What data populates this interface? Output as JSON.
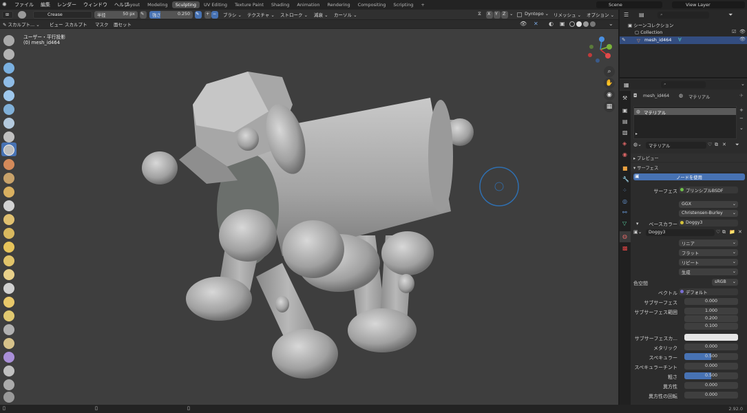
{
  "menu": {
    "items": [
      "ファイル",
      "編集",
      "レンダー",
      "ウィンドウ",
      "ヘルプ"
    ]
  },
  "workspace_tabs": [
    {
      "label": "Layout"
    },
    {
      "label": "Modeling"
    },
    {
      "label": "Sculpting",
      "active": true
    },
    {
      "label": "UV Editing"
    },
    {
      "label": "Texture Paint"
    },
    {
      "label": "Shading"
    },
    {
      "label": "Animation"
    },
    {
      "label": "Rendering"
    },
    {
      "label": "Compositing"
    },
    {
      "label": "Scripting"
    }
  ],
  "scene": {
    "name": "Scene",
    "view_layer": "View Layer"
  },
  "tool_header": {
    "brush": "Crease",
    "radius_label": "半径",
    "radius_value": "50 px",
    "strength_label": "強さ",
    "strength_value": "0.250",
    "plus": "+",
    "minus": "−",
    "brush_menu": "ブラシ",
    "texture_menu": "テクスチャ",
    "stroke_menu": "ストローク",
    "falloff_menu": "減衰",
    "cursor_menu": "カーソル",
    "dyntopo": "Dyntopo",
    "remesh": "リメッシュ",
    "options": "オプション",
    "x": "X",
    "y": "Y",
    "z": "Z"
  },
  "viewport_header": {
    "mode": "スカルプト...",
    "view": "ビュー",
    "sculpt": "スカルプト",
    "mask": "マスク",
    "face_sets": "面セット"
  },
  "viewport": {
    "view_name": "ユーザー・平行投影",
    "object_label": "(0) mesh_id464",
    "mesh_color": "#b8b8b8",
    "brush_circle_color": "#2f6fb0"
  },
  "outliner": {
    "search_placeholder": "",
    "scene_collection": "シーンコレクション",
    "collection": "Collection",
    "object": "mesh_id464"
  },
  "properties": {
    "object_name": "mesh_id464",
    "material_tab": "マテリアル",
    "slot_name": "マテリアル",
    "material_name": "マテリアル",
    "preview": "プレビュー",
    "surface_section": "サーフェス",
    "use_nodes": "ノードを使用",
    "surface_label": "サーフェス",
    "surface_value": "プリンシプルBSDF",
    "distribution": "GGX",
    "subsurface_method": "Christensen-Burley",
    "base_color_label": "ベースカラー",
    "base_color_value": "Doggy3",
    "image_name": "Doggy3",
    "interpolation": "リニア",
    "projection": "フラット",
    "extension": "リピート",
    "source": "生成",
    "color_space_label": "色空間",
    "color_space_value": "sRGB",
    "vector_label": "ベクトル",
    "vector_value": "デフォルト",
    "params": [
      {
        "label": "サブサーフェス",
        "value": "0.000"
      },
      {
        "label": "サブサーフェス範囲",
        "value": "1.000"
      },
      {
        "label": "",
        "value": "0.200"
      },
      {
        "label": "",
        "value": "0.100"
      },
      {
        "label": "サブサーフェスカ...",
        "value": ""
      },
      {
        "label": "メタリック",
        "value": "0.000"
      },
      {
        "label": "スペキュラー",
        "value": "0.500",
        "fill": 0.5
      },
      {
        "label": "スペキュラーチント",
        "value": "0.000"
      },
      {
        "label": "粗さ",
        "value": "0.500",
        "fill": 0.5
      },
      {
        "label": "異方性",
        "value": "0.000"
      },
      {
        "label": "異方性の回転",
        "value": "0.000"
      }
    ]
  },
  "statusbar": {
    "version": "2.92.0"
  },
  "colors": {
    "accent": "#4772b3",
    "surface_dot": "#6fbf4a",
    "color_dot": "#d4c23a",
    "vector_dot": "#7a6fd4"
  }
}
